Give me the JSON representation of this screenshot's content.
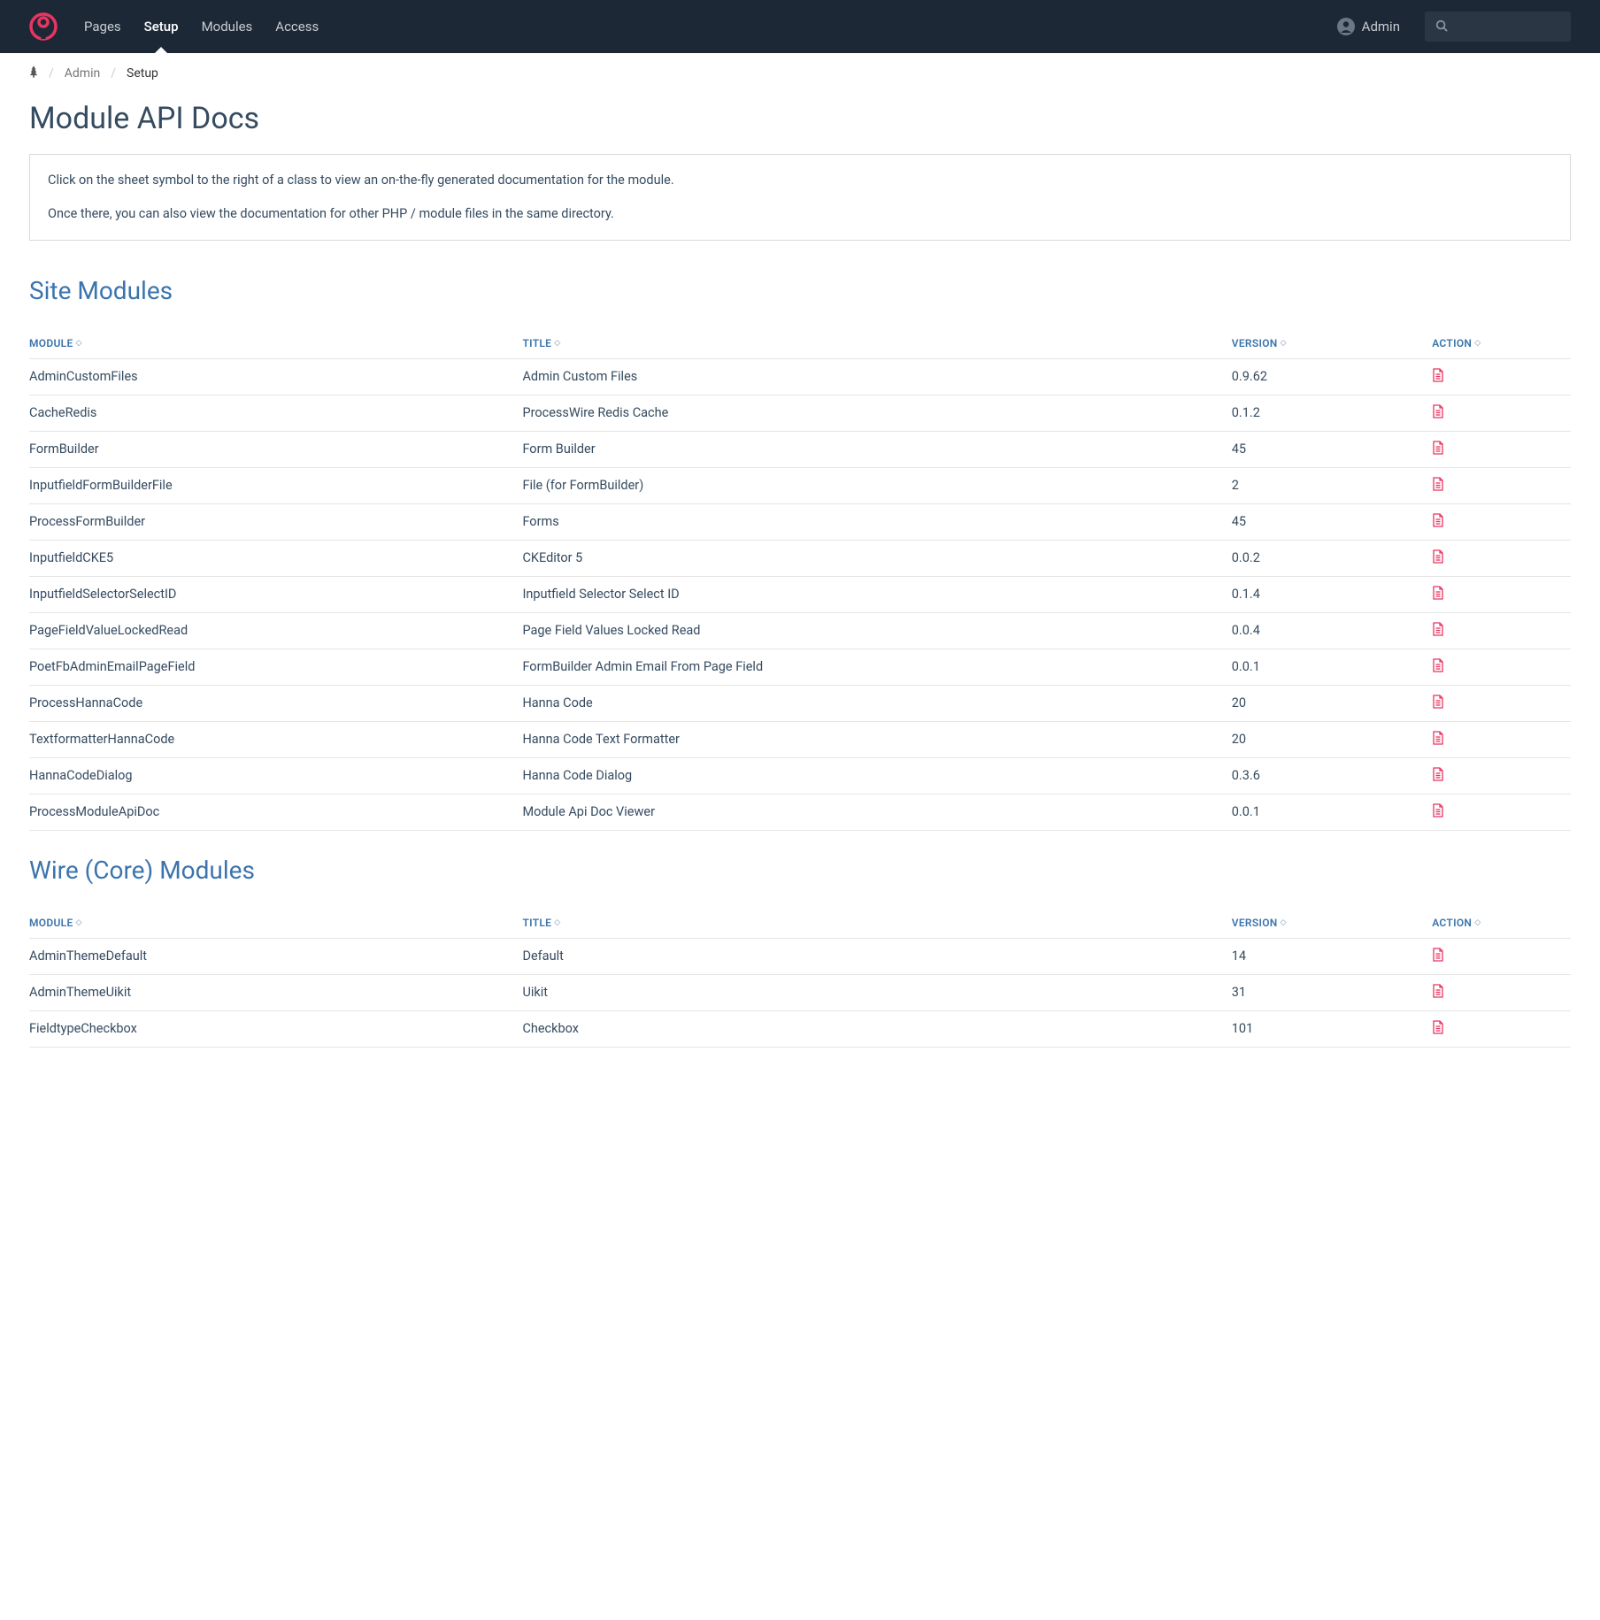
{
  "nav": {
    "items": [
      {
        "label": "Pages"
      },
      {
        "label": "Setup"
      },
      {
        "label": "Modules"
      },
      {
        "label": "Access"
      }
    ],
    "active_index": 1,
    "user": "Admin"
  },
  "breadcrumb": {
    "items": [
      {
        "label": "Admin"
      },
      {
        "label": "Setup"
      }
    ]
  },
  "page_title": "Module API Docs",
  "info": {
    "p1": "Click on the sheet symbol to the right of a class to view an on-the-fly generated documentation for the module.",
    "p2": "Once there, you can also view the documentation for other PHP / module files in the same directory."
  },
  "sections": [
    {
      "title": "Site Modules",
      "headers": {
        "module": "Module",
        "title": "Title",
        "version": "Version",
        "action": "Action"
      },
      "rows": [
        {
          "module": "AdminCustomFiles",
          "title": "Admin Custom Files",
          "version": "0.9.62"
        },
        {
          "module": "CacheRedis",
          "title": "ProcessWire Redis Cache",
          "version": "0.1.2"
        },
        {
          "module": "FormBuilder",
          "title": "Form Builder",
          "version": "45"
        },
        {
          "module": "InputfieldFormBuilderFile",
          "title": "File (for FormBuilder)",
          "version": "2"
        },
        {
          "module": "ProcessFormBuilder",
          "title": "Forms",
          "version": "45"
        },
        {
          "module": "InputfieldCKE5",
          "title": "CKEditor 5",
          "version": "0.0.2"
        },
        {
          "module": "InputfieldSelectorSelectID",
          "title": "Inputfield Selector Select ID",
          "version": "0.1.4"
        },
        {
          "module": "PageFieldValueLockedRead",
          "title": "Page Field Values Locked Read",
          "version": "0.0.4"
        },
        {
          "module": "PoetFbAdminEmailPageField",
          "title": "FormBuilder Admin Email From Page Field",
          "version": "0.0.1"
        },
        {
          "module": "ProcessHannaCode",
          "title": "Hanna Code",
          "version": "20"
        },
        {
          "module": "TextformatterHannaCode",
          "title": "Hanna Code Text Formatter",
          "version": "20"
        },
        {
          "module": "HannaCodeDialog",
          "title": "Hanna Code Dialog",
          "version": "0.3.6"
        },
        {
          "module": "ProcessModuleApiDoc",
          "title": "Module Api Doc Viewer",
          "version": "0.0.1"
        }
      ]
    },
    {
      "title": "Wire (Core) Modules",
      "headers": {
        "module": "Module",
        "title": "Title",
        "version": "Version",
        "action": "Action"
      },
      "rows": [
        {
          "module": "AdminThemeDefault",
          "title": "Default",
          "version": "14"
        },
        {
          "module": "AdminThemeUikit",
          "title": "Uikit",
          "version": "31"
        },
        {
          "module": "FieldtypeCheckbox",
          "title": "Checkbox",
          "version": "101"
        }
      ]
    }
  ]
}
